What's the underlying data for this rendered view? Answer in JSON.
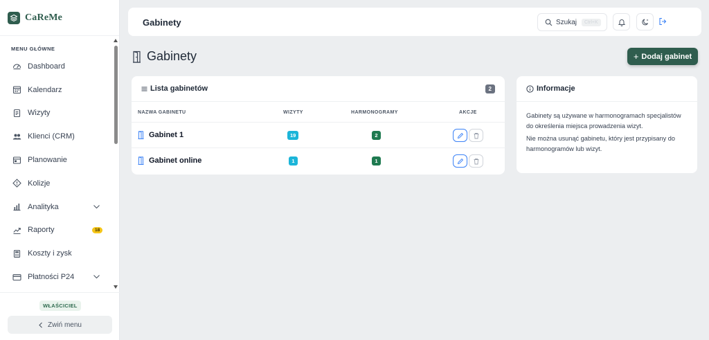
{
  "brand": {
    "name": "CaReMe"
  },
  "sidebar": {
    "section_title": "MENU GŁÓWNE",
    "items": [
      {
        "label": "Dashboard",
        "icon": "gauge-icon"
      },
      {
        "label": "Kalendarz",
        "icon": "calendar-icon"
      },
      {
        "label": "Wizyty",
        "icon": "clipboard-icon"
      },
      {
        "label": "Klienci (CRM)",
        "icon": "users-icon"
      },
      {
        "label": "Planowanie",
        "icon": "window-icon"
      },
      {
        "label": "Kolizje",
        "icon": "warning-diamond-icon"
      },
      {
        "label": "Analityka",
        "icon": "bar-chart-icon",
        "expandable": true
      },
      {
        "label": "Raporty",
        "icon": "trend-icon",
        "badge": "18"
      },
      {
        "label": "Koszty i zysk",
        "icon": "calculator-icon"
      },
      {
        "label": "Płatności P24",
        "icon": "card-icon",
        "expandable": true
      }
    ],
    "role": "WŁAŚCICIEL",
    "collapse_label": "Zwiń menu"
  },
  "topbar": {
    "title": "Gabinety",
    "search_label": "Szukaj",
    "search_shortcut": "Ctrl+K"
  },
  "page": {
    "title": "Gabinety",
    "add_button": "Dodaj gabinet"
  },
  "list": {
    "title": "Lista gabinetów",
    "count": "2",
    "columns": [
      "NAZWA GABINETU",
      "WIZYTY",
      "HARMONOGRAMY",
      "AKCJE"
    ],
    "rows": [
      {
        "name": "Gabinet 1",
        "visits": "19",
        "schedules": "2"
      },
      {
        "name": "Gabinet online",
        "visits": "1",
        "schedules": "1"
      }
    ]
  },
  "info": {
    "title": "Informacje",
    "p1": "Gabinety są używane w harmonogramach specjalistów do określenia miejsca prowadzenia wizyt.",
    "p2": "Nie można usunąć gabinetu, który jest przypisany do harmonogramów lub wizyt."
  },
  "colors": {
    "brand": "#2f5d4e",
    "visits_pill": "#1cb5d9",
    "schedules_pill": "#1f7a50",
    "badge_yellow": "#f5c518"
  }
}
